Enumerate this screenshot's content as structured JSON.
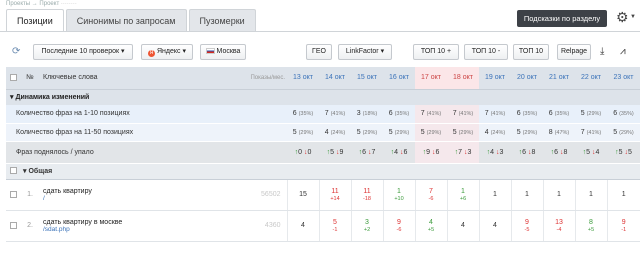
{
  "breadcrumb": {
    "home": "Проекты",
    "sep": "→",
    "project_label": "Проект",
    "project_name": "········"
  },
  "tabs": [
    {
      "label": "Позиции",
      "active": true
    },
    {
      "label": "Синонимы по запросам",
      "active": false
    },
    {
      "label": "Пузомерки",
      "active": false
    }
  ],
  "header": {
    "hint_button": "Подсказки по разделу",
    "settings_icon": "gear-icon"
  },
  "toolbar": {
    "last_checks": "Последние 10 проверок",
    "search_engine": "Яндекс",
    "region": "Москва",
    "geo": "ГЕО",
    "linkfactor": "LinkFactor",
    "top10plus": "ТОП 10 +",
    "top10minus": "ТОП 10 -",
    "top10": "ТОП 10",
    "relpage": "Relpage"
  },
  "table": {
    "col_num": "№",
    "col_keywords": "Ключевые слова",
    "col_shows": "Показы/мес.",
    "dates": [
      "13 окт",
      "14 окт",
      "15 окт",
      "16 окт",
      "17 окт",
      "18 окт",
      "19 окт",
      "20 окт",
      "21 окт",
      "22 окт",
      "23 окт"
    ],
    "highlight_dates": [
      4,
      5
    ]
  },
  "dynamics": {
    "title": "Динамика изменений",
    "rows": [
      {
        "label": "Количество фраз на 1-10 позициях",
        "cells": [
          [
            "6",
            "(35%)"
          ],
          [
            "7",
            "(41%)"
          ],
          [
            "3",
            "(18%)"
          ],
          [
            "6",
            "(35%)"
          ],
          [
            "7",
            "(41%)"
          ],
          [
            "7",
            "(41%)"
          ],
          [
            "7",
            "(41%)"
          ],
          [
            "6",
            "(35%)"
          ],
          [
            "6",
            "(35%)"
          ],
          [
            "5",
            "(29%)"
          ],
          [
            "6",
            "(35%)"
          ]
        ]
      },
      {
        "label": "Количество фраз на 11-50 позициях",
        "cells": [
          [
            "5",
            "(29%)"
          ],
          [
            "4",
            "(24%)"
          ],
          [
            "5",
            "(29%)"
          ],
          [
            "5",
            "(29%)"
          ],
          [
            "5",
            "(29%)"
          ],
          [
            "5",
            "(29%)"
          ],
          [
            "4",
            "(24%)"
          ],
          [
            "5",
            "(29%)"
          ],
          [
            "8",
            "(47%)"
          ],
          [
            "7",
            "(41%)"
          ],
          [
            "5",
            "(29%)"
          ]
        ]
      },
      {
        "label": "Фраз поднялось / упало",
        "cells": [
          [
            "0",
            "0"
          ],
          [
            "5",
            "9"
          ],
          [
            "6",
            "7"
          ],
          [
            "4",
            "6"
          ],
          [
            "9",
            "6"
          ],
          [
            "7",
            "3"
          ],
          [
            "4",
            "3"
          ],
          [
            "6",
            "8"
          ],
          [
            "6",
            "8"
          ],
          [
            "5",
            "4"
          ],
          [
            "5",
            "5"
          ]
        ]
      }
    ]
  },
  "group": {
    "title": "Общая"
  },
  "keywords": [
    {
      "num": "1.",
      "text": "сдать квартиру",
      "url": "/",
      "shows": "56502",
      "positions": [
        [
          "15",
          ""
        ],
        [
          "11",
          "+14"
        ],
        [
          "11",
          "-18"
        ],
        [
          "1",
          "+10"
        ],
        [
          "7",
          "-6"
        ],
        [
          "1",
          "+6"
        ],
        [
          "1",
          ""
        ],
        [
          "1",
          ""
        ],
        [
          "1",
          ""
        ],
        [
          "1",
          ""
        ],
        [
          "1",
          ""
        ]
      ],
      "dirs": [
        "n",
        "dn",
        "dn",
        "up",
        "dn",
        "up",
        "n",
        "n",
        "n",
        "n",
        "n"
      ]
    },
    {
      "num": "2.",
      "text": "сдать квартиру в москве",
      "url": "/sdat.php",
      "shows": "4360",
      "positions": [
        [
          "4",
          ""
        ],
        [
          "5",
          "-1"
        ],
        [
          "3",
          "+2"
        ],
        [
          "9",
          "-6"
        ],
        [
          "4",
          "+5"
        ],
        [
          "4",
          ""
        ],
        [
          "4",
          ""
        ],
        [
          "9",
          "-5"
        ],
        [
          "13",
          "-4"
        ],
        [
          "8",
          "+5"
        ],
        [
          "9",
          "-1"
        ]
      ],
      "dirs": [
        "n",
        "dn",
        "up",
        "dn",
        "up",
        "n",
        "n",
        "dn",
        "dn",
        "up",
        "dn"
      ]
    }
  ]
}
